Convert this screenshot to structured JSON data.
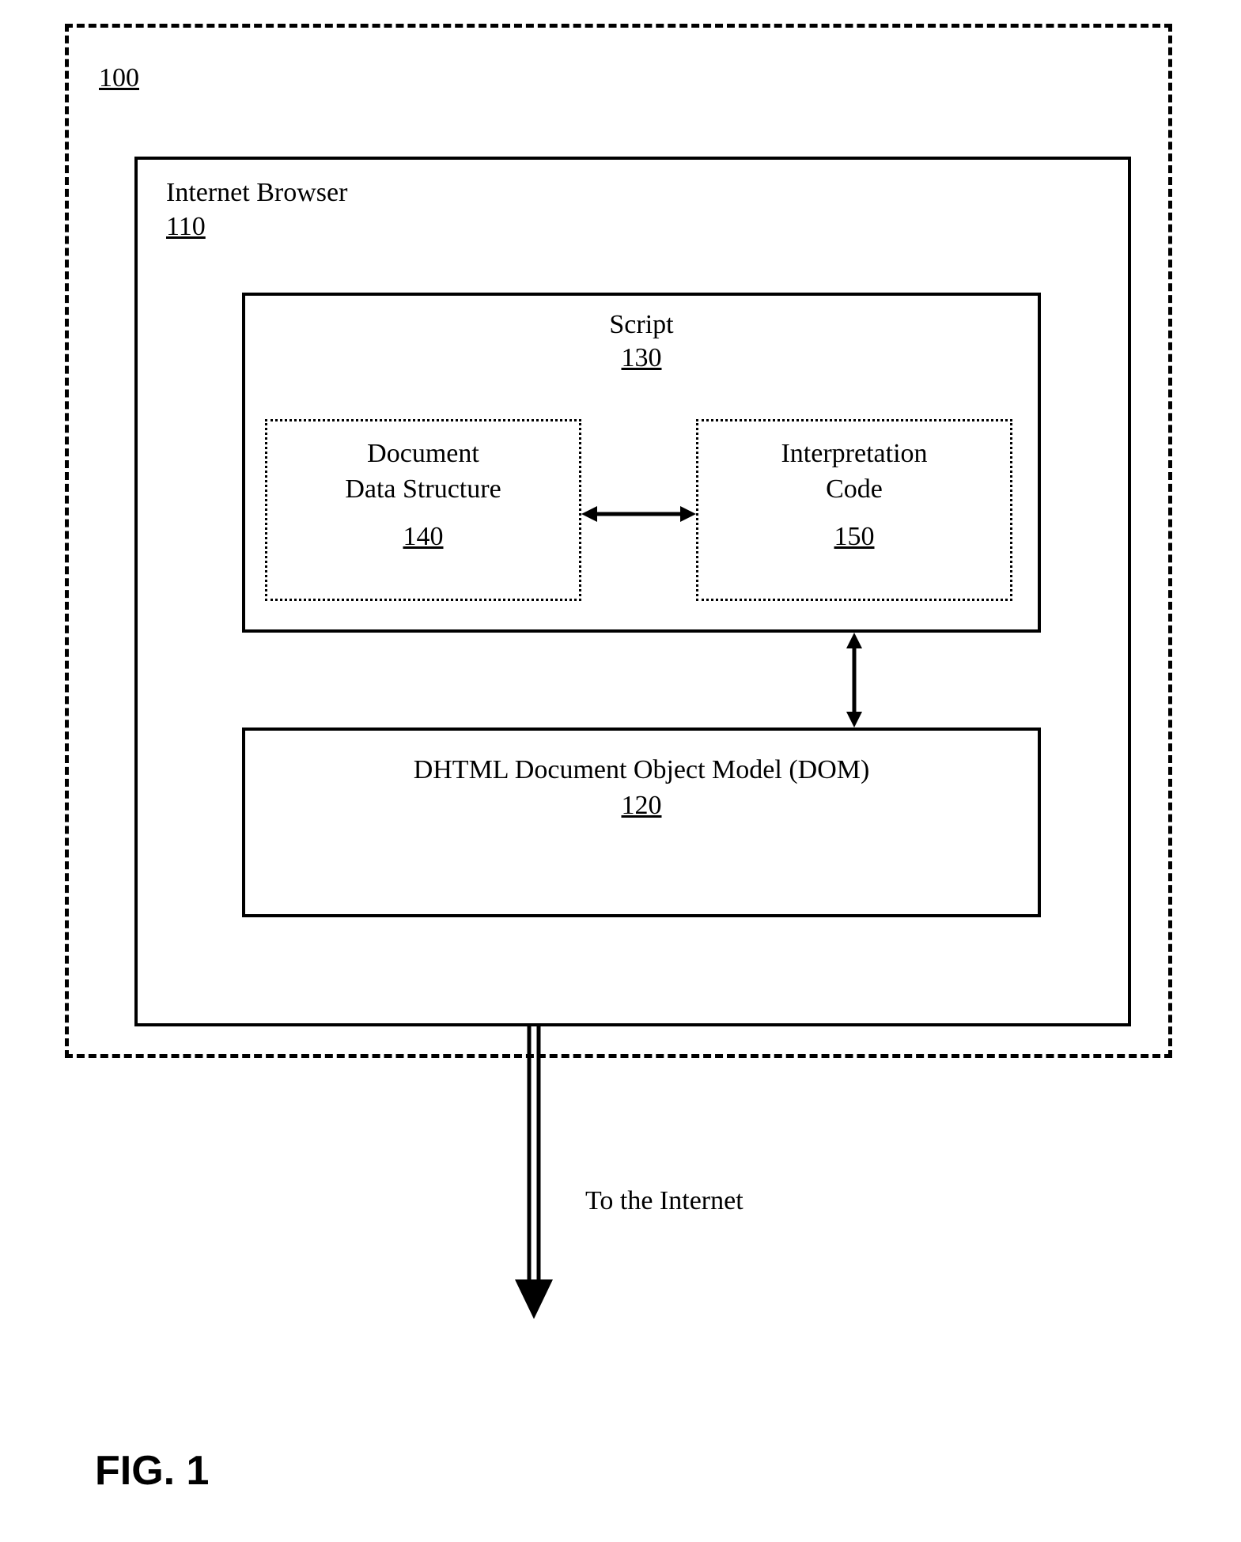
{
  "outer": {
    "num": "100"
  },
  "browser": {
    "title": "Internet Browser",
    "num": "110"
  },
  "script": {
    "title": "Script",
    "num": "130"
  },
  "docdata": {
    "line1": "Document",
    "line2": "Data Structure",
    "num": "140"
  },
  "interp": {
    "line1": "Interpretation",
    "line2": "Code",
    "num": "150"
  },
  "dom": {
    "title": "DHTML Document Object Model (DOM)",
    "num": "120"
  },
  "internet_label": "To the Internet",
  "figure_caption": "FIG. 1"
}
